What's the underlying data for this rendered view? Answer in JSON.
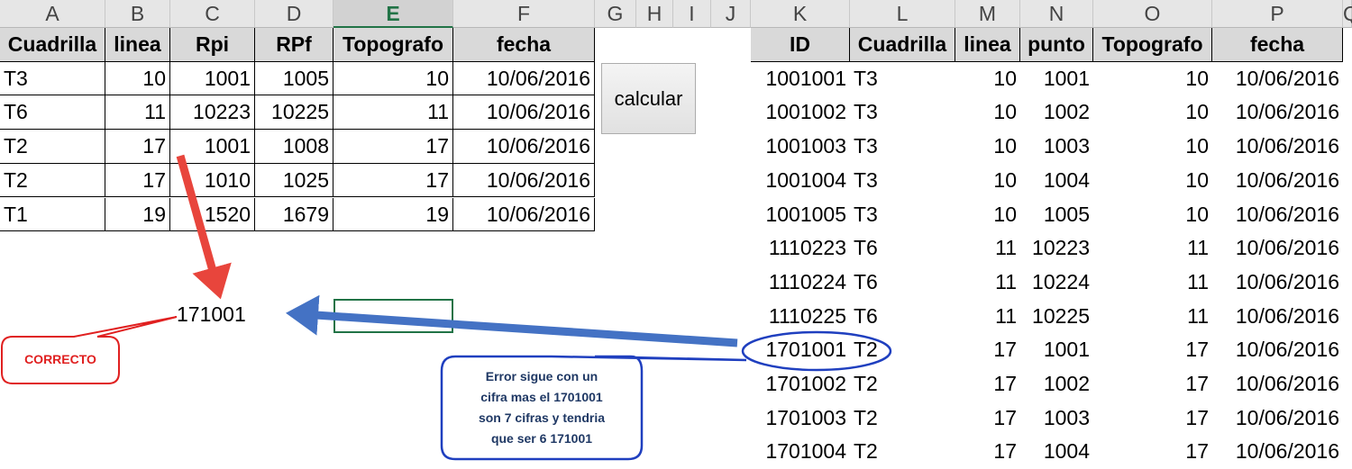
{
  "columns": [
    "A",
    "B",
    "C",
    "D",
    "E",
    "F",
    "G",
    "H",
    "I",
    "J",
    "K",
    "L",
    "M",
    "N",
    "O",
    "P",
    "Q"
  ],
  "selected_column": "E",
  "left_table": {
    "headers": [
      "Cuadrilla",
      "linea",
      "Rpi",
      "RPf",
      "Topografo",
      "fecha"
    ],
    "rows": [
      [
        "T3",
        "10",
        "1001",
        "1005",
        "10",
        "10/06/2016"
      ],
      [
        "T6",
        "11",
        "10223",
        "10225",
        "11",
        "10/06/2016"
      ],
      [
        "T2",
        "17",
        "1001",
        "1008",
        "17",
        "10/06/2016"
      ],
      [
        "T2",
        "17",
        "1010",
        "1025",
        "17",
        "10/06/2016"
      ],
      [
        "T1",
        "19",
        "1520",
        "1679",
        "19",
        "10/06/2016"
      ]
    ]
  },
  "right_table": {
    "headers": [
      "ID",
      "Cuadrilla",
      "linea",
      "punto",
      "Topografo",
      "fecha"
    ],
    "rows": [
      [
        "1001001",
        "T3",
        "10",
        "1001",
        "10",
        "10/06/2016"
      ],
      [
        "1001002",
        "T3",
        "10",
        "1002",
        "10",
        "10/06/2016"
      ],
      [
        "1001003",
        "T3",
        "10",
        "1003",
        "10",
        "10/06/2016"
      ],
      [
        "1001004",
        "T3",
        "10",
        "1004",
        "10",
        "10/06/2016"
      ],
      [
        "1001005",
        "T3",
        "10",
        "1005",
        "10",
        "10/06/2016"
      ],
      [
        "1110223",
        "T6",
        "11",
        "10223",
        "11",
        "10/06/2016"
      ],
      [
        "1110224",
        "T6",
        "11",
        "10224",
        "11",
        "10/06/2016"
      ],
      [
        "1110225",
        "T6",
        "11",
        "10225",
        "11",
        "10/06/2016"
      ],
      [
        "1701001",
        "T2",
        "17",
        "1001",
        "17",
        "10/06/2016"
      ],
      [
        "1701002",
        "T2",
        "17",
        "1002",
        "17",
        "10/06/2016"
      ],
      [
        "1701003",
        "T2",
        "17",
        "1003",
        "17",
        "10/06/2016"
      ],
      [
        "1701004",
        "T2",
        "17",
        "1004",
        "17",
        "10/06/2016"
      ]
    ]
  },
  "button_label": "calcular",
  "result_value": "171001",
  "annotations": {
    "correcto": "CORRECTO",
    "error_lines": [
      "Error sigue con un",
      "cifra mas el 1701001",
      "son 7 cifras y tendria",
      "que ser 6 171001"
    ]
  },
  "colors": {
    "header_fill": "#d9d9d9",
    "selection_green": "#217346",
    "arrow_red": "#e8453c",
    "arrow_blue": "#4472c4",
    "callout_red": "#e02020",
    "callout_blue": "#1f3fbf",
    "callout_text_blue": "#1f3864"
  }
}
